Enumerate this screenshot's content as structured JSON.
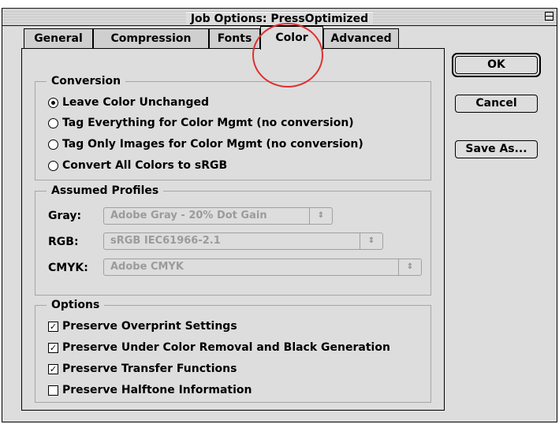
{
  "window": {
    "title": "Job Options: PressOptimized"
  },
  "tabs": [
    {
      "label": "General",
      "active": false
    },
    {
      "label": "Compression",
      "active": false
    },
    {
      "label": "Fonts",
      "active": false
    },
    {
      "label": "Color",
      "active": true
    },
    {
      "label": "Advanced",
      "active": false
    }
  ],
  "conversion": {
    "title": "Conversion",
    "options": [
      {
        "label": "Leave Color Unchanged",
        "selected": true
      },
      {
        "label": "Tag Everything for Color Mgmt (no conversion)",
        "selected": false
      },
      {
        "label": "Tag Only Images for Color Mgmt (no conversion)",
        "selected": false
      },
      {
        "label": "Convert All Colors to sRGB",
        "selected": false
      }
    ]
  },
  "profiles": {
    "title": "Assumed Profiles",
    "gray": {
      "label": "Gray:",
      "value": "Adobe Gray - 20% Dot Gain",
      "enabled": false
    },
    "rgb": {
      "label": "RGB:",
      "value": "sRGB IEC61966-2.1",
      "enabled": false
    },
    "cmyk": {
      "label": "CMYK:",
      "value": "Adobe CMYK",
      "enabled": false
    }
  },
  "options": {
    "title": "Options",
    "items": [
      {
        "label": "Preserve Overprint Settings",
        "checked": true
      },
      {
        "label": "Preserve Under Color Removal and Black Generation",
        "checked": true
      },
      {
        "label": "Preserve Transfer Functions",
        "checked": true
      },
      {
        "label": "Preserve Halftone Information",
        "checked": false
      }
    ]
  },
  "buttons": {
    "ok": "OK",
    "cancel": "Cancel",
    "save_as": "Save As..."
  },
  "icons": {
    "popup_arrow": "updown-arrows-icon",
    "check": "checkmark-icon"
  },
  "colors": {
    "highlight_circle": "#e03030",
    "window_bg": "#dddddd"
  }
}
